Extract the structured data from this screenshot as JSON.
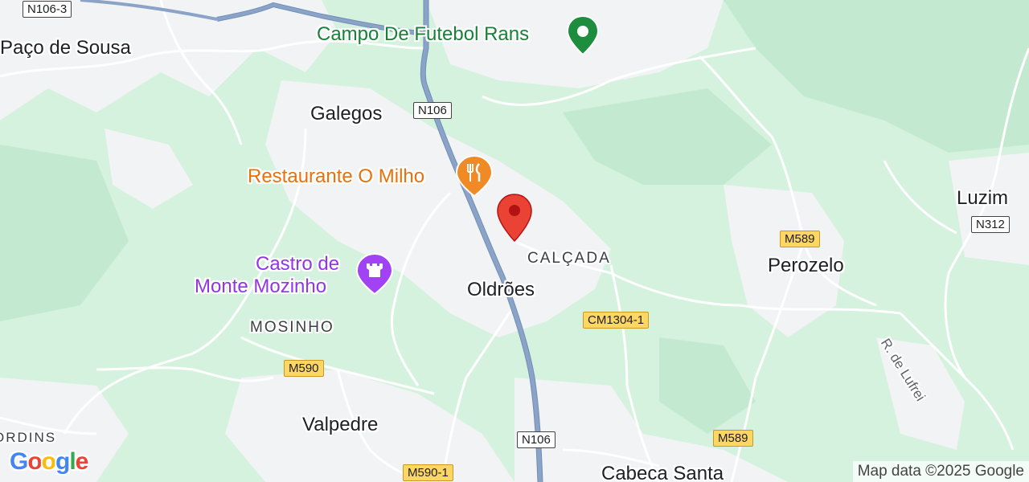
{
  "map": {
    "places": {
      "paco_de_sousa": "Paço de Sousa",
      "galegos": "Galegos",
      "luzim": "Luzim",
      "perozelo": "Perozelo",
      "oldroes": "Oldrões",
      "valpedre": "Valpedre",
      "cabeca_santa": "Cabeca Santa",
      "calcada": "CALÇADA",
      "mosinho": "MOSINHO",
      "ordins": "ORDINS"
    },
    "pois": {
      "campo": "Campo De Futebol Rans",
      "restaurante": "Restaurante O Milho",
      "castro_line1": "Castro de",
      "castro_line2": "Monte Mozinho"
    },
    "roads": {
      "n106_3": "N106-3",
      "n106_top": "N106",
      "n106_bottom": "N106",
      "n312": "N312",
      "m589_top": "M589",
      "m589_bottom": "M589",
      "cm1304_1": "CM1304-1",
      "m590": "M590",
      "m590_1": "M590-1",
      "r_de_lufrei": "R. de Lufrei"
    },
    "colors": {
      "land": "#d4f2dd",
      "built_up": "#f1f3f4",
      "highway": "#8ba3c6",
      "pin": "#ea4335",
      "poi_green": "#188038",
      "poi_orange": "#e8710a",
      "poi_purple": "#9334e6"
    },
    "icons": [
      "location-pin-icon",
      "soccer-field-icon",
      "fork-knife-icon",
      "castle-icon"
    ]
  },
  "footer": {
    "logo_letters": [
      "G",
      "o",
      "o",
      "g",
      "l",
      "e"
    ],
    "attribution": "Map data ©2025 Google"
  }
}
